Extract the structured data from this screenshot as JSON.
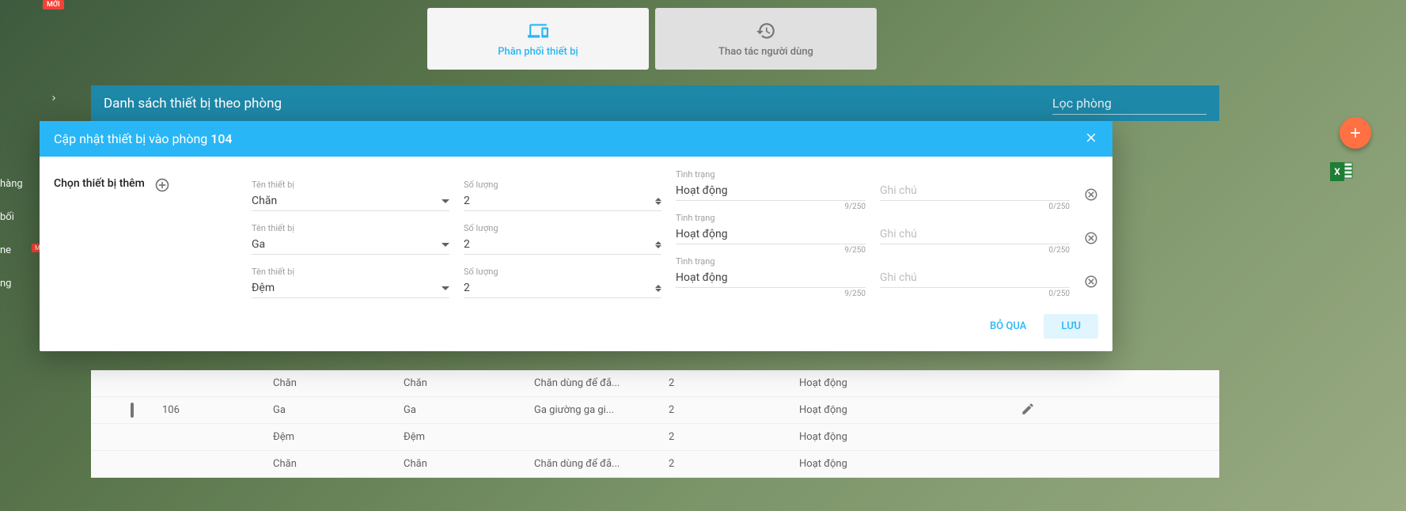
{
  "badges": {
    "moi": "MỚI"
  },
  "top_tabs": {
    "distribute": "Phân phối thiết bị",
    "user_action": "Thao tác người dùng"
  },
  "side": {
    "items": [
      "hàng",
      "bối",
      "ne",
      "ng"
    ]
  },
  "panel": {
    "title": "Danh sách thiết bị theo phòng",
    "filter_placeholder": "Lọc phòng"
  },
  "modal": {
    "title_prefix": "Cập nhật thiết bị vào phòng ",
    "room": "104",
    "add_label": "Chọn thiết bị thêm",
    "labels": {
      "name": "Tên thiết bị",
      "qty": "Số lượng",
      "status": "Tình trạng",
      "note_placeholder": "Ghi chú"
    },
    "rows": [
      {
        "name": "Chăn",
        "qty": "2",
        "status": "Hoạt động",
        "status_counter": "9/250",
        "note_counter": "0/250"
      },
      {
        "name": "Ga",
        "qty": "2",
        "status": "Hoạt động",
        "status_counter": "9/250",
        "note_counter": "0/250"
      },
      {
        "name": "Đệm",
        "qty": "2",
        "status": "Hoạt động",
        "status_counter": "9/250",
        "note_counter": "0/250"
      }
    ],
    "buttons": {
      "skip": "BỎ QUA",
      "save": "LƯU"
    }
  },
  "table": {
    "rows": [
      {
        "room": "",
        "c1": "Chăn",
        "c2": "Chăn",
        "c3": "Chăn dùng để đắ...",
        "c4": "2",
        "c5": "Hoạt động",
        "cb": false,
        "edit": false
      },
      {
        "room": "106",
        "c1": "Ga",
        "c2": "Ga",
        "c3": "Ga giường ga gi...",
        "c4": "2",
        "c5": "Hoạt động",
        "cb": true,
        "edit": true
      },
      {
        "room": "",
        "c1": "Đệm",
        "c2": "Đệm",
        "c3": "",
        "c4": "2",
        "c5": "Hoạt động",
        "cb": false,
        "edit": false
      },
      {
        "room": "",
        "c1": "Chăn",
        "c2": "Chăn",
        "c3": "Chăn dùng để đắ...",
        "c4": "2",
        "c5": "Hoạt động",
        "cb": false,
        "edit": false
      }
    ]
  }
}
